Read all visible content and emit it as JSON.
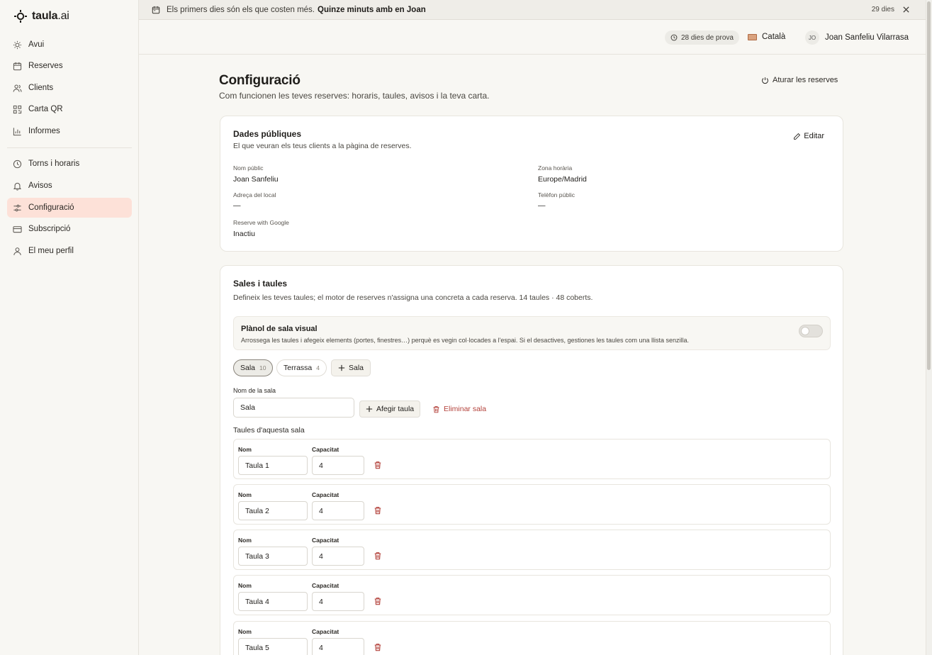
{
  "app": {
    "logo_text": "taula",
    "logo_suffix": ".ai"
  },
  "sidebar": {
    "items": [
      {
        "label": "Avui",
        "icon": "sun-icon"
      },
      {
        "label": "Reserves",
        "icon": "calendar-icon"
      },
      {
        "label": "Clients",
        "icon": "users-icon"
      },
      {
        "label": "Carta QR",
        "icon": "qr-icon"
      },
      {
        "label": "Informes",
        "icon": "bar-chart-icon"
      },
      {
        "label": "Torns i horaris",
        "icon": "clock-icon"
      },
      {
        "label": "Avisos",
        "icon": "bell-icon"
      },
      {
        "label": "Configuració",
        "icon": "sliders-icon",
        "active": true
      },
      {
        "label": "Subscripció",
        "icon": "credit-card-icon"
      },
      {
        "label": "El meu perfil",
        "icon": "user-icon"
      }
    ]
  },
  "banner": {
    "text": "Els primers dies són els que costen més.",
    "cta": "Quinze minuts amb en Joan",
    "days": "29 dies"
  },
  "topbar": {
    "trial": "28 dies de prova",
    "language": "Català",
    "user_initials": "JO",
    "user_name": "Joan Sanfeliu Vilarrasa"
  },
  "page": {
    "title": "Configuració",
    "subtitle": "Com funcionen les teves reserves: horaris, taules, avisos i la teva carta.",
    "stop_button": "Aturar les reserves"
  },
  "public_data": {
    "title": "Dades públiques",
    "subtitle": "El que veuran els teus clients a la pàgina de reserves.",
    "edit": "Editar",
    "fields": {
      "public_name_label": "Nom públic",
      "public_name_value": "Joan Sanfeliu",
      "timezone_label": "Zona horària",
      "timezone_value": "Europe/Madrid",
      "address_label": "Adreça del local",
      "address_value": "—",
      "phone_label": "Telèfon públic",
      "phone_value": "—",
      "rwg_label": "Reserve with Google",
      "rwg_value": "Inactiu"
    }
  },
  "rooms": {
    "title": "Sales i taules",
    "subtitle": "Defineix les teves taules; el motor de reserves n'assigna una concreta a cada reserva. 14 taules · 48 coberts.",
    "visual_title": "Plànol de sala visual",
    "visual_desc": "Arrossega les taules i afegeix elements (portes, finestres…) perquè es vegin col·locades a l'espai. Si el desactives, gestiones les taules com una llista senzilla.",
    "visual_enabled": false,
    "tabs": [
      {
        "label": "Sala",
        "count": "10",
        "active": true
      },
      {
        "label": "Terrassa",
        "count": "4",
        "active": false
      }
    ],
    "add_room": "Sala",
    "room_name_label": "Nom de la sala",
    "room_name_value": "Sala",
    "add_table": "Afegir taula",
    "delete_room": "Eliminar sala",
    "tables_heading": "Taules d'aquesta sala",
    "col_name": "Nom",
    "col_capacity": "Capacitat",
    "tables": [
      {
        "name": "Taula 1",
        "capacity": "4"
      },
      {
        "name": "Taula 2",
        "capacity": "4"
      },
      {
        "name": "Taula 3",
        "capacity": "4"
      },
      {
        "name": "Taula 4",
        "capacity": "4"
      },
      {
        "name": "Taula 5",
        "capacity": "4"
      }
    ]
  },
  "colors": {
    "accent_bg": "#fde1d8",
    "danger": "#b3413a"
  }
}
